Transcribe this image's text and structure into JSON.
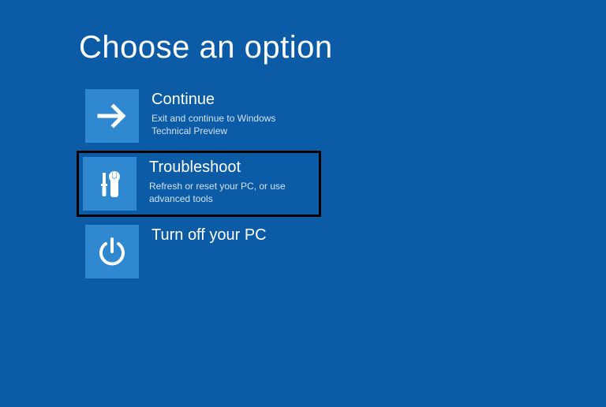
{
  "title": "Choose an option",
  "options": {
    "continue": {
      "title": "Continue",
      "desc": "Exit and continue to Windows Technical Preview"
    },
    "troubleshoot": {
      "title": "Troubleshoot",
      "desc": "Refresh or reset your PC, or use advanced tools"
    },
    "turnoff": {
      "title": "Turn off your PC",
      "desc": ""
    }
  }
}
